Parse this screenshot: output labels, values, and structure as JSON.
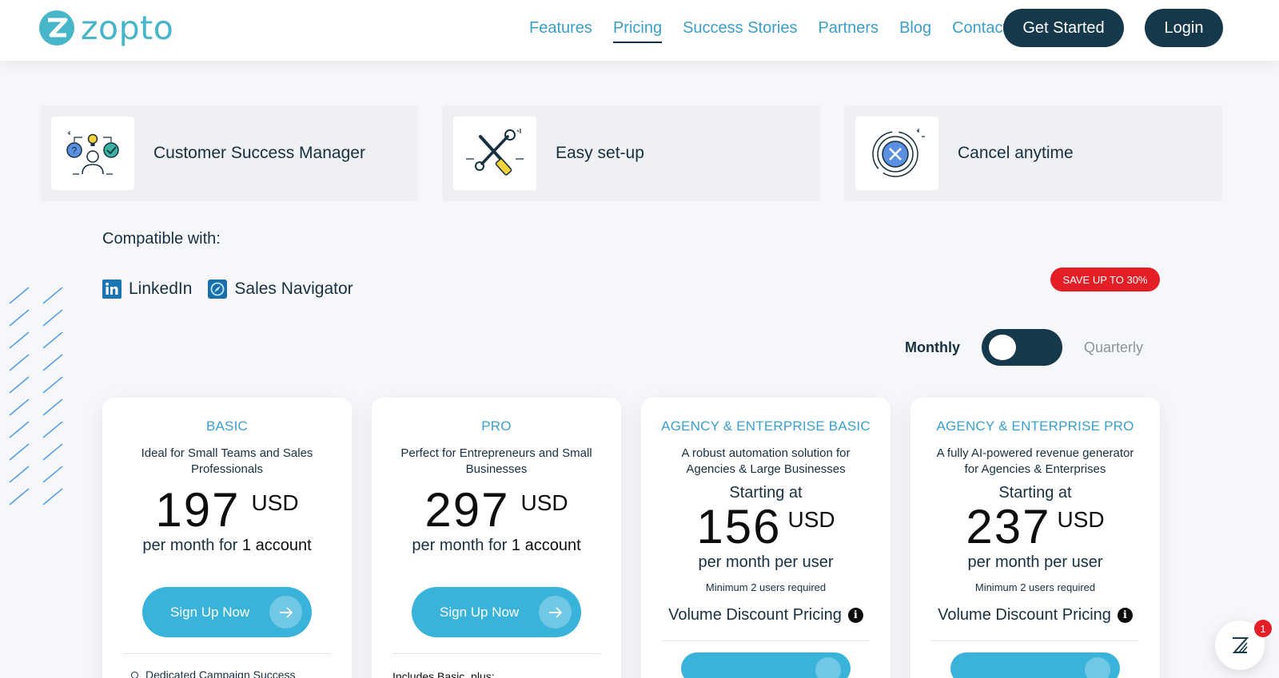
{
  "brand": {
    "name": "zopto",
    "color": "#46b6c8"
  },
  "nav": {
    "items": [
      {
        "label": "Features",
        "active": false
      },
      {
        "label": "Pricing",
        "active": true
      },
      {
        "label": "Success Stories",
        "active": false
      },
      {
        "label": "Partners",
        "active": false
      },
      {
        "label": "Blog",
        "active": false
      },
      {
        "label": "Contact",
        "active": false
      }
    ],
    "get_started": "Get Started",
    "login": "Login"
  },
  "features": [
    {
      "label": "Customer Success Manager",
      "icon": "customer-success-icon"
    },
    {
      "label": "Easy set-up",
      "icon": "tools-icon"
    },
    {
      "label": "Cancel anytime",
      "icon": "cancel-icon"
    }
  ],
  "compatible": {
    "title": "Compatible with:",
    "items": [
      {
        "label": "LinkedIn",
        "icon": "linkedin-icon"
      },
      {
        "label": "Sales Navigator",
        "icon": "sales-navigator-icon"
      }
    ]
  },
  "billing": {
    "save_badge": "SAVE UP TO 30%",
    "monthly": "Monthly",
    "quarterly": "Quarterly",
    "selected": "Monthly"
  },
  "plans": [
    {
      "name": "BASIC",
      "desc": "Ideal for Small Teams and Sales Professionals",
      "price": "197",
      "currency": "USD",
      "per_prefix": "per month for",
      "per_bold": "1 account",
      "signup": "Sign Up Now",
      "first_feature": "Dedicated Campaign Success"
    },
    {
      "name": "PRO",
      "desc": "Perfect for Entrepreneurs and Small Businesses",
      "price": "297",
      "currency": "USD",
      "per_prefix": "per month for",
      "per_bold": "1 account",
      "signup": "Sign Up Now",
      "includes": "Includes Basic, plus:"
    },
    {
      "name": "AGENCY & ENTERPRISE BASIC",
      "desc": "A robust automation solution for Agencies & Large Businesses",
      "starting": "Starting at",
      "price": "156",
      "currency": "USD",
      "per_line": "per month per user",
      "min_users": "Minimum 2 users required",
      "volume": "Volume Discount Pricing"
    },
    {
      "name": "AGENCY & ENTERPRISE PRO",
      "desc": "A fully AI-powered revenue generator for Agencies & Enterprises",
      "starting": "Starting at",
      "price": "237",
      "currency": "USD",
      "per_line": "per month per user",
      "min_users": "Minimum 2 users required",
      "volume": "Volume Discount Pricing"
    }
  ],
  "chat": {
    "badge_count": "1"
  },
  "colors": {
    "dark": "#15394a",
    "accent": "#3ab3db",
    "nav": "#3a9fc9",
    "badge": "#e41e26"
  }
}
